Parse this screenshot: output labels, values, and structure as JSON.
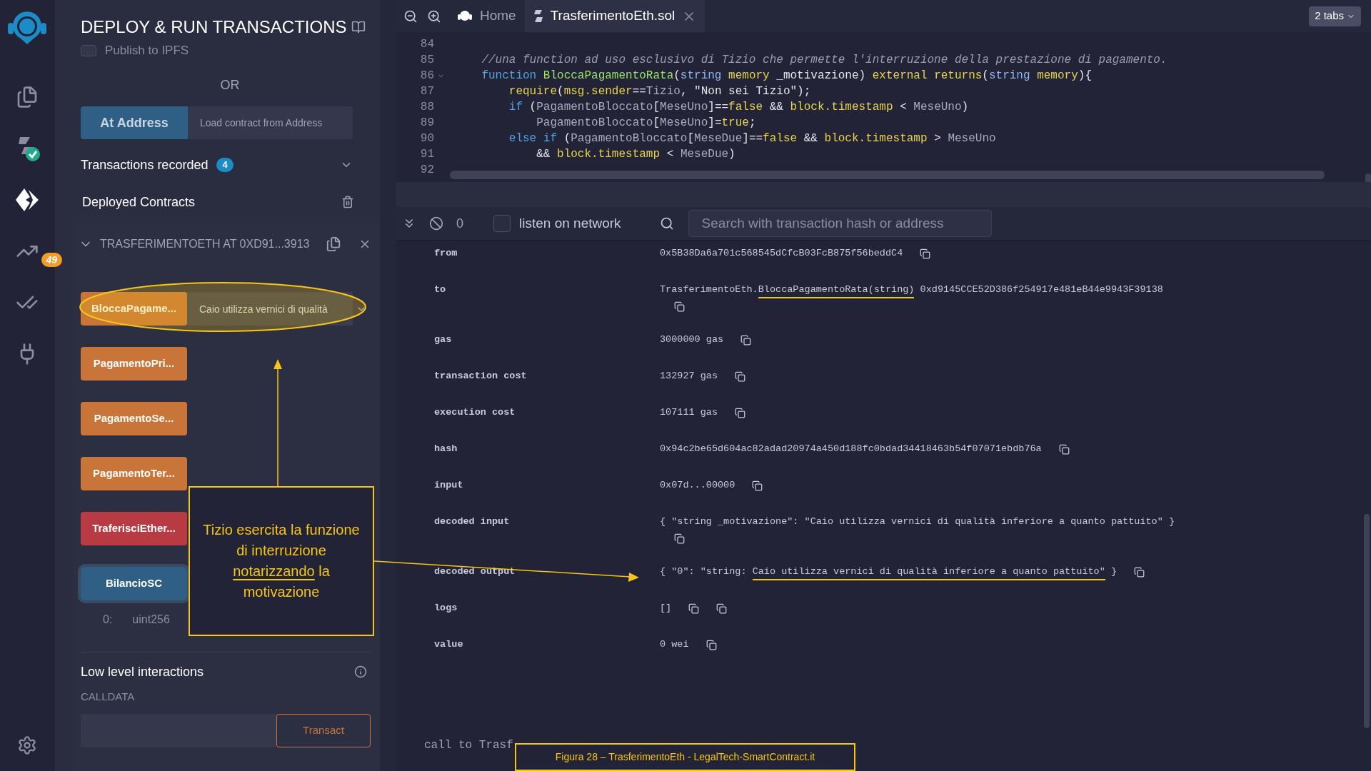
{
  "sidebar": {
    "items": [
      {
        "kind": "files",
        "selected": false
      },
      {
        "kind": "compiler",
        "selected": false
      },
      {
        "kind": "deploy",
        "selected": true
      },
      {
        "kind": "analysis",
        "selected": false,
        "badge": "49"
      },
      {
        "kind": "tests",
        "selected": false
      },
      {
        "kind": "plugins",
        "selected": false
      }
    ]
  },
  "panel": {
    "title": "DEPLOY & RUN TRANSACTIONS",
    "publish": {
      "label": "Publish to IPFS",
      "checked": false
    },
    "or": "OR",
    "at_address": {
      "button": "At Address",
      "placeholder": "Load contract from Address"
    },
    "transactions_recorded": {
      "label": "Transactions recorded",
      "count": "4"
    },
    "deployed_contracts": {
      "label": "Deployed Contracts"
    },
    "contract": {
      "title": "TRASFERIMENTOETH AT 0XD91...3913",
      "expanded": true,
      "functions": [
        {
          "label": "BloccaPagame...",
          "kind": "transact",
          "value": "Caio utilizza vernici di qualità"
        },
        {
          "label": "PagamentoPri...",
          "kind": "transact"
        },
        {
          "label": "PagamentoSe...",
          "kind": "transact"
        },
        {
          "label": "PagamentoTer...",
          "kind": "transact"
        },
        {
          "label": "TraferisciEther...",
          "kind": "payable"
        },
        {
          "label": "BilancioSC",
          "kind": "call"
        }
      ],
      "output": {
        "index": "0:",
        "type": "uint256"
      }
    },
    "low_level": {
      "title": "Low level interactions",
      "calldata_label": "CALLDATA",
      "button": "Transact"
    }
  },
  "editor": {
    "tabs": [
      {
        "label": "Home",
        "kind": "home",
        "selected": false
      },
      {
        "label": "TrasferimentoEth.sol",
        "kind": "file",
        "selected": true
      }
    ],
    "tabs_menu": "2 tabs",
    "lines": [
      {
        "number": "84",
        "foldable": false
      },
      {
        "number": "85",
        "foldable": false,
        "tokens": [
          {
            "text": "    //una function ad uso esclusivo di Tizio che permette l'interruzione della prestazione di pagamento.",
            "kind": "comment"
          }
        ]
      },
      {
        "number": "86",
        "foldable": true,
        "tokens": [
          {
            "text": "    function",
            "kind": "keyword"
          },
          {
            "text": " BloccaPagamentoRata",
            "kind": "function"
          },
          {
            "text": "(",
            "kind": "plain"
          },
          {
            "text": "string",
            "kind": "type"
          },
          {
            "text": " memory",
            "kind": "modifier"
          },
          {
            "text": " _motivazione) ",
            "kind": "plain"
          },
          {
            "text": "external",
            "kind": "modifier"
          },
          {
            "text": " returns",
            "kind": "modifier"
          },
          {
            "text": "(",
            "kind": "plain"
          },
          {
            "text": "string",
            "kind": "type"
          },
          {
            "text": " memory",
            "kind": "modifier"
          },
          {
            "text": "){",
            "kind": "plain"
          }
        ]
      },
      {
        "number": "87",
        "foldable": false,
        "tokens": [
          {
            "text": "        require",
            "kind": "modifier"
          },
          {
            "text": "(",
            "kind": "plain"
          },
          {
            "text": "msg.sender",
            "kind": "modifier"
          },
          {
            "text": "==",
            "kind": "plain"
          },
          {
            "text": "Tizio",
            "kind": "identifier"
          },
          {
            "text": ", \"Non sei Tizio\");",
            "kind": "plain"
          }
        ]
      },
      {
        "number": "88",
        "foldable": false,
        "tokens": [
          {
            "text": "        if",
            "kind": "keyword"
          },
          {
            "text": " (",
            "kind": "plain"
          },
          {
            "text": "PagamentoBloccato",
            "kind": "identifier"
          },
          {
            "text": "[",
            "kind": "plain"
          },
          {
            "text": "MeseUno",
            "kind": "identifier"
          },
          {
            "text": "]==",
            "kind": "plain"
          },
          {
            "text": "false",
            "kind": "modifier"
          },
          {
            "text": " && ",
            "kind": "plain"
          },
          {
            "text": "block.timestamp",
            "kind": "modifier"
          },
          {
            "text": " < ",
            "kind": "plain"
          },
          {
            "text": "MeseUno",
            "kind": "identifier"
          },
          {
            "text": ")",
            "kind": "plain"
          }
        ]
      },
      {
        "number": "89",
        "foldable": false,
        "tokens": [
          {
            "text": "            PagamentoBloccato",
            "kind": "identifier"
          },
          {
            "text": "[",
            "kind": "plain"
          },
          {
            "text": "MeseUno",
            "kind": "identifier"
          },
          {
            "text": "]=",
            "kind": "plain"
          },
          {
            "text": "true",
            "kind": "modifier"
          },
          {
            "text": ";",
            "kind": "plain"
          }
        ]
      },
      {
        "number": "90",
        "foldable": false,
        "tokens": [
          {
            "text": "        else if",
            "kind": "keyword"
          },
          {
            "text": " (",
            "kind": "plain"
          },
          {
            "text": "PagamentoBloccato",
            "kind": "identifier"
          },
          {
            "text": "[",
            "kind": "plain"
          },
          {
            "text": "MeseDue",
            "kind": "identifier"
          },
          {
            "text": "]==",
            "kind": "plain"
          },
          {
            "text": "false",
            "kind": "modifier"
          },
          {
            "text": " && ",
            "kind": "plain"
          },
          {
            "text": "block.timestamp",
            "kind": "modifier"
          },
          {
            "text": " > ",
            "kind": "plain"
          },
          {
            "text": "MeseUno",
            "kind": "identifier"
          }
        ]
      },
      {
        "number": "91",
        "foldable": false,
        "tokens": [
          {
            "text": "            && ",
            "kind": "plain"
          },
          {
            "text": "block.timestamp",
            "kind": "modifier"
          },
          {
            "text": " < ",
            "kind": "plain"
          },
          {
            "text": "MeseDue",
            "kind": "identifier"
          },
          {
            "text": ")",
            "kind": "plain"
          }
        ]
      },
      {
        "number": "92",
        "foldable": false
      }
    ]
  },
  "terminal": {
    "pending": "0",
    "listen": {
      "label": "listen on network",
      "checked": false
    },
    "search": {
      "placeholder": "Search with transaction hash or address"
    },
    "rows": [
      {
        "kind": "field",
        "label": "from",
        "parts": [
          {
            "text": "0x5B38Da6a701c568545dCfcB03FcB875f56beddC4",
            "underlined": false
          }
        ],
        "copy_below": false
      },
      {
        "kind": "field",
        "label": "to",
        "parts": [
          {
            "text": "TrasferimentoEth.",
            "underlined": false
          },
          {
            "text": "BloccaPagamentoRata(string)",
            "underlined": true
          },
          {
            "text": " 0xd9145CCE52D386f254917e481eB44e9943F39138",
            "underlined": false
          }
        ],
        "copy_below": true
      },
      {
        "kind": "field",
        "label": "gas",
        "parts": [
          {
            "text": "3000000 gas",
            "underlined": false
          }
        ],
        "copy_below": false
      },
      {
        "kind": "field",
        "label": "transaction cost",
        "parts": [
          {
            "text": "132927 gas",
            "underlined": false
          }
        ],
        "copy_below": false
      },
      {
        "kind": "field",
        "label": "execution cost",
        "parts": [
          {
            "text": "107111 gas",
            "underlined": false
          }
        ],
        "copy_below": false
      },
      {
        "kind": "field",
        "label": "hash",
        "parts": [
          {
            "text": "0x94c2be65d604ac82adad20974a450d188fc0bdad34418463b54f07071ebdb76a",
            "underlined": false
          }
        ],
        "copy_below": false
      },
      {
        "kind": "field",
        "label": "input",
        "parts": [
          {
            "text": "0x07d...00000",
            "underlined": false
          }
        ],
        "copy_below": false
      },
      {
        "kind": "field",
        "label": "decoded input",
        "parts": [
          {
            "text": "{ \"string _motivazione\": \"Caio utilizza vernici di qualità inferiore a quanto pattuito\" }",
            "underlined": false
          }
        ],
        "copy_below": true
      },
      {
        "kind": "field",
        "label": "decoded output",
        "parts": [
          {
            "text": "{ \"0\": \"string: ",
            "underlined": false
          },
          {
            "text": "Caio utilizza vernici di qualità inferiore a quanto pattuito\"",
            "underlined": true
          },
          {
            "text": " }",
            "underlined": false
          }
        ],
        "copy_below": false
      },
      {
        "kind": "logs",
        "label": "logs",
        "parts": [
          {
            "text": "[]",
            "underlined": false
          }
        ],
        "copy_below": false
      },
      {
        "kind": "field",
        "label": "value",
        "parts": [
          {
            "text": "0 wei",
            "underlined": false
          }
        ],
        "copy_below": false
      }
    ],
    "footer": "call to Trasf"
  },
  "annotation": {
    "callout": [
      {
        "text": "Tizio esercita la funzione di interruzione ",
        "underlined": false
      },
      {
        "text": "notarizzando",
        "underlined": true
      },
      {
        "text": " la motivazione",
        "underlined": false
      }
    ]
  },
  "caption": "Figura 28 – TrasferimentoEth - LegalTech-SmartContract.it"
}
